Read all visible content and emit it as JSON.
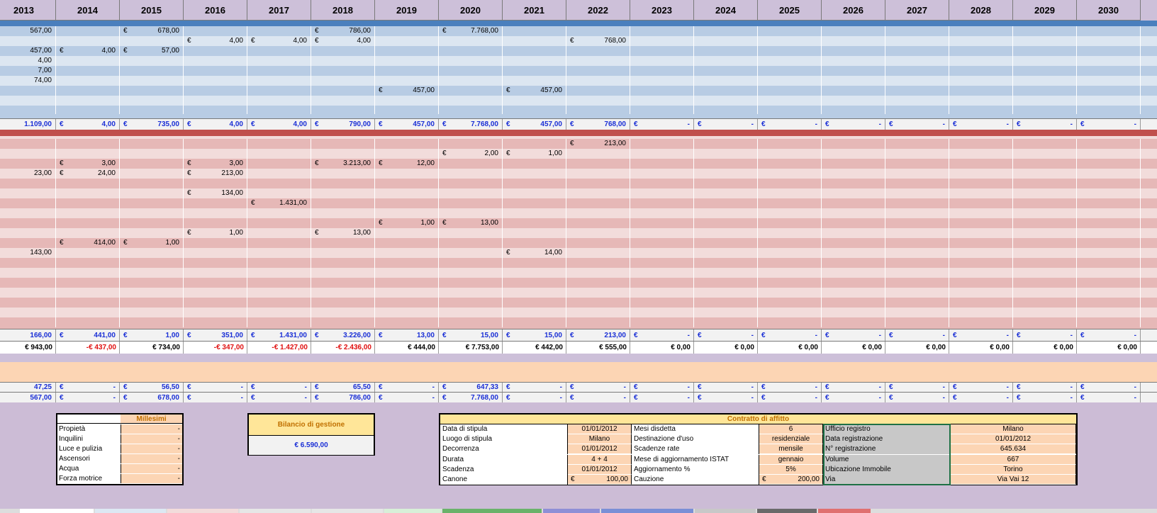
{
  "years": [
    "2013",
    "2014",
    "2015",
    "2016",
    "2017",
    "2018",
    "2019",
    "2020",
    "2021",
    "2022",
    "2023",
    "2024",
    "2025",
    "2026",
    "2027",
    "2028",
    "2029",
    "2030"
  ],
  "currency": "€",
  "colors": {
    "header_bg": "#cdc0d9",
    "income_band": "#4a7fbd",
    "expense_band": "#c0504d",
    "blue_row_a": "#b8cce4",
    "blue_row_b": "#dce6f1",
    "pink_row_a": "#e6b8b7",
    "pink_row_b": "#f2dcdb",
    "orange_row": "#fcd5b4",
    "total_bg": "#f2f2f2",
    "positive_text": "#1a2fd6",
    "negative_text": "#e01010"
  },
  "income_rows": [
    {
      "cells": [
        {
          "v": "567,00",
          "e": false
        },
        null,
        {
          "v": "678,00",
          "e": true
        },
        null,
        null,
        {
          "v": "786,00",
          "e": true
        },
        null,
        {
          "v": "7.768,00",
          "e": true
        },
        null,
        null,
        null,
        null,
        null,
        null,
        null,
        null,
        null,
        null
      ]
    },
    {
      "cells": [
        null,
        null,
        null,
        {
          "v": "4,00",
          "e": true
        },
        {
          "v": "4,00",
          "e": true
        },
        {
          "v": "4,00",
          "e": true
        },
        null,
        null,
        null,
        {
          "v": "768,00",
          "e": true
        },
        null,
        null,
        null,
        null,
        null,
        null,
        null,
        null
      ]
    },
    {
      "cells": [
        {
          "v": "457,00",
          "e": false
        },
        {
          "v": "4,00",
          "e": true
        },
        {
          "v": "57,00",
          "e": true
        },
        null,
        null,
        null,
        null,
        null,
        null,
        null,
        null,
        null,
        null,
        null,
        null,
        null,
        null,
        null
      ]
    },
    {
      "cells": [
        {
          "v": "4,00",
          "e": false
        },
        null,
        null,
        null,
        null,
        null,
        null,
        null,
        null,
        null,
        null,
        null,
        null,
        null,
        null,
        null,
        null,
        null
      ]
    },
    {
      "cells": [
        {
          "v": "7,00",
          "e": false
        },
        null,
        null,
        null,
        null,
        null,
        null,
        null,
        null,
        null,
        null,
        null,
        null,
        null,
        null,
        null,
        null,
        null
      ]
    },
    {
      "cells": [
        {
          "v": "74,00",
          "e": false
        },
        null,
        null,
        null,
        null,
        null,
        null,
        null,
        null,
        null,
        null,
        null,
        null,
        null,
        null,
        null,
        null,
        null
      ]
    },
    {
      "cells": [
        null,
        null,
        null,
        null,
        null,
        null,
        {
          "v": "457,00",
          "e": true
        },
        null,
        {
          "v": "457,00",
          "e": true
        },
        null,
        null,
        null,
        null,
        null,
        null,
        null,
        null,
        null
      ]
    },
    {
      "cells": [
        null,
        null,
        null,
        null,
        null,
        null,
        null,
        null,
        null,
        null,
        null,
        null,
        null,
        null,
        null,
        null,
        null,
        null
      ]
    },
    {
      "cells": [
        null,
        null,
        null,
        null,
        null,
        null,
        null,
        null,
        null,
        null,
        null,
        null,
        null,
        null,
        null,
        null,
        null,
        null
      ]
    }
  ],
  "income_total": [
    "1.109,00",
    "4,00",
    "735,00",
    "4,00",
    "4,00",
    "790,00",
    "457,00",
    "7.768,00",
    "457,00",
    "768,00",
    "-",
    "-",
    "-",
    "-",
    "-",
    "-",
    "-",
    "-"
  ],
  "expense_rows": [
    {
      "cells": [
        null,
        null,
        null,
        null,
        null,
        null,
        null,
        null,
        null,
        {
          "v": "213,00",
          "e": true
        },
        null,
        null,
        null,
        null,
        null,
        null,
        null,
        null
      ]
    },
    {
      "cells": [
        null,
        null,
        null,
        null,
        null,
        null,
        null,
        {
          "v": "2,00",
          "e": true
        },
        {
          "v": "1,00",
          "e": true
        },
        null,
        null,
        null,
        null,
        null,
        null,
        null,
        null,
        null
      ]
    },
    {
      "cells": [
        null,
        {
          "v": "3,00",
          "e": true
        },
        null,
        {
          "v": "3,00",
          "e": true
        },
        null,
        {
          "v": "3.213,00",
          "e": true
        },
        {
          "v": "12,00",
          "e": true
        },
        null,
        null,
        null,
        null,
        null,
        null,
        null,
        null,
        null,
        null,
        null
      ]
    },
    {
      "cells": [
        {
          "v": "23,00",
          "e": false
        },
        {
          "v": "24,00",
          "e": true
        },
        null,
        {
          "v": "213,00",
          "e": true
        },
        null,
        null,
        null,
        null,
        null,
        null,
        null,
        null,
        null,
        null,
        null,
        null,
        null,
        null
      ]
    },
    {
      "cells": [
        null,
        null,
        null,
        null,
        null,
        null,
        null,
        null,
        null,
        null,
        null,
        null,
        null,
        null,
        null,
        null,
        null,
        null
      ]
    },
    {
      "cells": [
        null,
        null,
        null,
        {
          "v": "134,00",
          "e": true
        },
        null,
        null,
        null,
        null,
        null,
        null,
        null,
        null,
        null,
        null,
        null,
        null,
        null,
        null
      ]
    },
    {
      "cells": [
        null,
        null,
        null,
        null,
        {
          "v": "1.431,00",
          "e": true
        },
        null,
        null,
        null,
        null,
        null,
        null,
        null,
        null,
        null,
        null,
        null,
        null,
        null
      ]
    },
    {
      "cells": [
        null,
        null,
        null,
        null,
        null,
        null,
        null,
        null,
        null,
        null,
        null,
        null,
        null,
        null,
        null,
        null,
        null,
        null
      ]
    },
    {
      "cells": [
        null,
        null,
        null,
        null,
        null,
        null,
        {
          "v": "1,00",
          "e": true
        },
        {
          "v": "13,00",
          "e": true
        },
        null,
        null,
        null,
        null,
        null,
        null,
        null,
        null,
        null,
        null
      ]
    },
    {
      "cells": [
        null,
        null,
        null,
        {
          "v": "1,00",
          "e": true
        },
        null,
        {
          "v": "13,00",
          "e": true
        },
        null,
        null,
        null,
        null,
        null,
        null,
        null,
        null,
        null,
        null,
        null,
        null
      ]
    },
    {
      "cells": [
        null,
        {
          "v": "414,00",
          "e": true
        },
        {
          "v": "1,00",
          "e": true
        },
        null,
        null,
        null,
        null,
        null,
        null,
        null,
        null,
        null,
        null,
        null,
        null,
        null,
        null,
        null
      ]
    },
    {
      "cells": [
        {
          "v": "143,00",
          "e": false
        },
        null,
        null,
        null,
        null,
        null,
        null,
        null,
        {
          "v": "14,00",
          "e": true
        },
        null,
        null,
        null,
        null,
        null,
        null,
        null,
        null,
        null
      ]
    },
    {
      "cells": [
        null,
        null,
        null,
        null,
        null,
        null,
        null,
        null,
        null,
        null,
        null,
        null,
        null,
        null,
        null,
        null,
        null,
        null
      ]
    },
    {
      "cells": [
        null,
        null,
        null,
        null,
        null,
        null,
        null,
        null,
        null,
        null,
        null,
        null,
        null,
        null,
        null,
        null,
        null,
        null
      ]
    },
    {
      "cells": [
        null,
        null,
        null,
        null,
        null,
        null,
        null,
        null,
        null,
        null,
        null,
        null,
        null,
        null,
        null,
        null,
        null,
        null
      ]
    },
    {
      "cells": [
        null,
        null,
        null,
        null,
        null,
        null,
        null,
        null,
        null,
        null,
        null,
        null,
        null,
        null,
        null,
        null,
        null,
        null
      ]
    },
    {
      "cells": [
        null,
        null,
        null,
        null,
        null,
        null,
        null,
        null,
        null,
        null,
        null,
        null,
        null,
        null,
        null,
        null,
        null,
        null
      ]
    },
    {
      "cells": [
        null,
        null,
        null,
        null,
        null,
        null,
        null,
        null,
        null,
        null,
        null,
        null,
        null,
        null,
        null,
        null,
        null,
        null
      ]
    },
    {
      "cells": [
        null,
        null,
        null,
        null,
        null,
        null,
        null,
        null,
        null,
        null,
        null,
        null,
        null,
        null,
        null,
        null,
        null,
        null
      ]
    }
  ],
  "expense_total": [
    "166,00",
    "441,00",
    "1,00",
    "351,00",
    "1.431,00",
    "3.226,00",
    "13,00",
    "15,00",
    "15,00",
    "213,00",
    "-",
    "-",
    "-",
    "-",
    "-",
    "-",
    "-",
    "-"
  ],
  "balance": [
    {
      "v": "€ 943,00",
      "neg": false
    },
    {
      "v": "-€ 437,00",
      "neg": true
    },
    {
      "v": "€ 734,00",
      "neg": false
    },
    {
      "v": "-€ 347,00",
      "neg": true
    },
    {
      "v": "-€ 1.427,00",
      "neg": true
    },
    {
      "v": "-€ 2.436,00",
      "neg": true
    },
    {
      "v": "€ 444,00",
      "neg": false
    },
    {
      "v": "€ 7.753,00",
      "neg": false
    },
    {
      "v": "€ 442,00",
      "neg": false
    },
    {
      "v": "€ 555,00",
      "neg": false
    },
    {
      "v": "€ 0,00",
      "neg": false
    },
    {
      "v": "€ 0,00",
      "neg": false
    },
    {
      "v": "€ 0,00",
      "neg": false
    },
    {
      "v": "€ 0,00",
      "neg": false
    },
    {
      "v": "€ 0,00",
      "neg": false
    },
    {
      "v": "€ 0,00",
      "neg": false
    },
    {
      "v": "€ 0,00",
      "neg": false
    },
    {
      "v": "€ 0,00",
      "neg": false
    }
  ],
  "summary_row_1": [
    "47,25",
    "-",
    "56,50",
    "-",
    "-",
    "65,50",
    "-",
    "647,33",
    "-",
    "-",
    "-",
    "-",
    "-",
    "-",
    "-",
    "-",
    "-",
    "-"
  ],
  "summary_row_2": [
    "567,00",
    "-",
    "678,00",
    "-",
    "-",
    "786,00",
    "-",
    "7.768,00",
    "-",
    "-",
    "-",
    "-",
    "-",
    "-",
    "-",
    "-",
    "-",
    "-"
  ],
  "millesimi": {
    "title": "Millesimi",
    "rows": [
      {
        "label": "Propietà",
        "value": "-"
      },
      {
        "label": "Inquilini",
        "value": "-"
      },
      {
        "label": "Luce e pulizia",
        "value": "-"
      },
      {
        "label": "Ascensori",
        "value": "-"
      },
      {
        "label": "Acqua",
        "value": "-"
      },
      {
        "label": "Forza motrice",
        "value": "-"
      }
    ]
  },
  "bilancio": {
    "title": "Bilancio di gestione",
    "value": "€ 6.590,00"
  },
  "contratto": {
    "title": "Contratto di affitto",
    "col1": [
      {
        "label": "Data di stipula",
        "value": "01/01/2012"
      },
      {
        "label": "Luogo di stipula",
        "value": "Milano"
      },
      {
        "label": "Decorrenza",
        "value": "01/01/2012"
      },
      {
        "label": "Durata",
        "value": "4 + 4"
      },
      {
        "label": "Scadenza",
        "value": "01/01/2012"
      },
      {
        "label": "Canone",
        "value": "100,00",
        "euro": true
      }
    ],
    "col2": [
      {
        "label": "Mesi disdetta",
        "value": "6"
      },
      {
        "label": "Destinazione d'uso",
        "value": "residenziale"
      },
      {
        "label": "Scadenze rate",
        "value": "mensile"
      },
      {
        "label": "Mese di aggiornamento ISTAT",
        "value": "gennaio"
      },
      {
        "label": "Aggiornamento %",
        "value": "5%"
      },
      {
        "label": "Cauzione",
        "value": "200,00",
        "euro": true
      }
    ],
    "col3": [
      {
        "label": "Ufficio registro",
        "value": "Milano"
      },
      {
        "label": "Data registrazione",
        "value": "01/01/2012"
      },
      {
        "label": "N° registrazione",
        "value": "645.634"
      },
      {
        "label": "Volume",
        "value": "667"
      },
      {
        "label": "Ubicazione Immobile",
        "value": "Torino"
      },
      {
        "label": "Via",
        "value": "Via Vai 12"
      }
    ]
  }
}
